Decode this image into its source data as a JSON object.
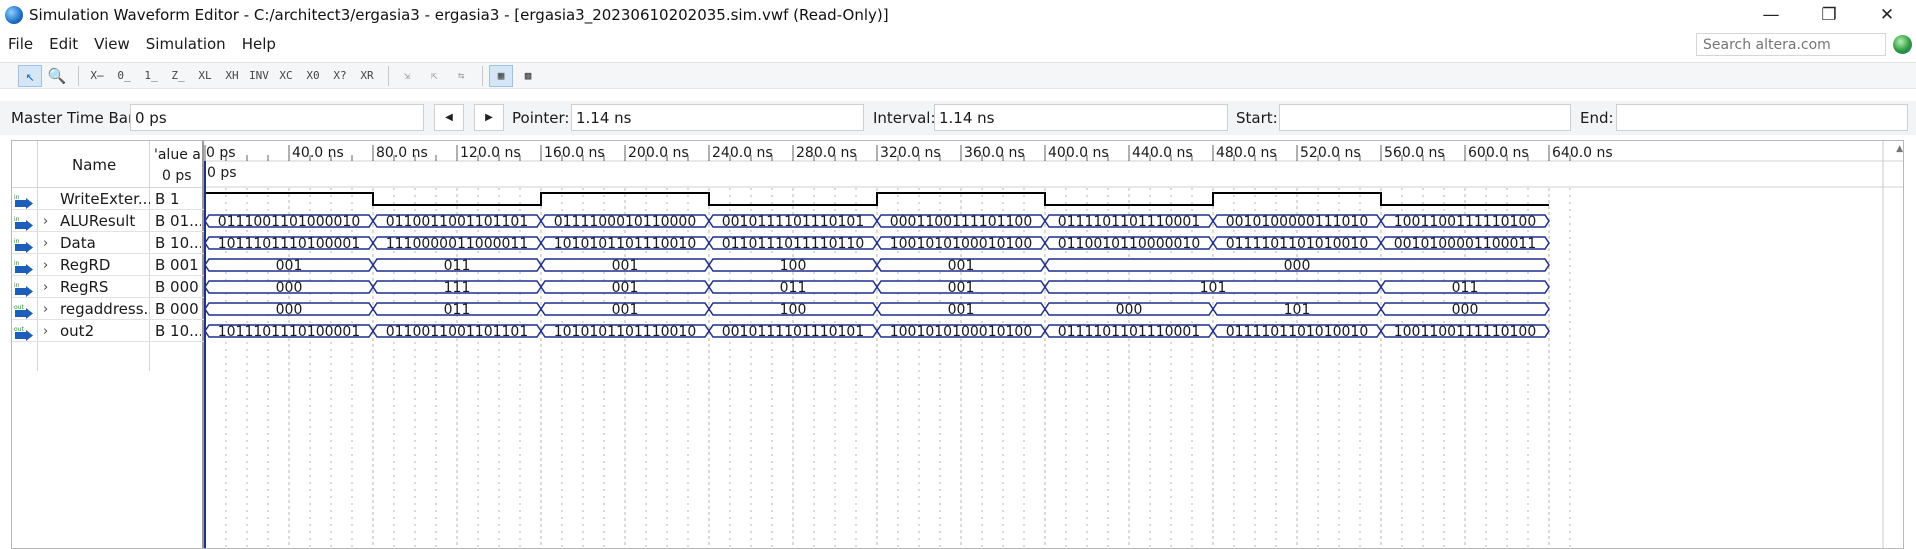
{
  "window": {
    "title": "Simulation Waveform Editor - C:/architect3/ergasia3 - ergasia3 - [ergasia3_20230610202035.sim.vwf (Read-Only)]",
    "minimize": "—",
    "maximize": "❐",
    "close": "✕"
  },
  "menu": {
    "items": [
      "File",
      "Edit",
      "View",
      "Simulation",
      "Help"
    ],
    "search_placeholder": "Search altera.com"
  },
  "toolbar": {
    "buttons": [
      {
        "icon": "pointer-icon",
        "glyph": "↖",
        "active": true
      },
      {
        "icon": "zoom-icon",
        "glyph": "🔍"
      },
      {
        "icon": "force-unknown-icon",
        "glyph": "X̶"
      },
      {
        "icon": "force-low-icon",
        "glyph": "0̲"
      },
      {
        "icon": "force-high-icon",
        "glyph": "1̲"
      },
      {
        "icon": "force-high-impedance-icon",
        "glyph": "Z̲"
      },
      {
        "icon": "force-weak-low-icon",
        "glyph": "XL"
      },
      {
        "icon": "force-weak-high-icon",
        "glyph": "XH"
      },
      {
        "icon": "invert-icon",
        "glyph": "INV"
      },
      {
        "icon": "count-value-icon",
        "glyph": "XC"
      },
      {
        "icon": "clock-icon",
        "glyph": "X0"
      },
      {
        "icon": "arbitrary-value-icon",
        "glyph": "X?"
      },
      {
        "icon": "random-value-icon",
        "glyph": "XR"
      },
      {
        "icon": "snap-icon",
        "glyph": "⇲"
      },
      {
        "icon": "snap-grid-icon",
        "glyph": "⇱"
      },
      {
        "icon": "snap-transition-icon",
        "glyph": "⇆"
      },
      {
        "icon": "fit-window-icon",
        "glyph": "▦",
        "active": true
      },
      {
        "icon": "grid-settings-icon",
        "glyph": "▩"
      }
    ]
  },
  "timebar": {
    "master_label": "Master Time Bar:",
    "master_value": "0 ps",
    "prev_glyph": "◀",
    "next_glyph": "▶",
    "pointer_label": "Pointer:",
    "pointer_value": "1.14 ns",
    "interval_label": "Interval:",
    "interval_value": "1.14 ns",
    "start_label": "Start:",
    "start_value": "",
    "end_label": "End:",
    "end_value": ""
  },
  "columns": {
    "name": "Name",
    "value_line1": "'alue a",
    "value_line2": "0 ps"
  },
  "time_ruler": {
    "labels": [
      "0 ps",
      "40.0 ns",
      "80.0 ns",
      "120.0 ns",
      "160.0 ns",
      "200.0 ns",
      "240.0 ns",
      "280.0 ns",
      "320.0 ns",
      "360.0 ns",
      "400.0 ns",
      "440.0 ns",
      "480.0 ns",
      "520.0 ns",
      "560.0 ns",
      "600.0 ns",
      "640.0 ns"
    ],
    "cursor_label": "0 ps"
  },
  "signals": [
    {
      "name": "WriteExter...",
      "value": "B 1",
      "io": "in",
      "expandable": false,
      "kind": "bit",
      "levels": [
        1,
        0,
        1,
        0,
        1,
        0,
        1,
        0
      ]
    },
    {
      "name": "ALUResult",
      "value": "B 01...",
      "io": "in",
      "expandable": true,
      "kind": "bus",
      "segments": [
        {
          "start": 0,
          "end": 80,
          "text": "0111001101000010"
        },
        {
          "start": 80,
          "end": 160,
          "text": "0110011001101101"
        },
        {
          "start": 160,
          "end": 240,
          "text": "0111100010110000"
        },
        {
          "start": 240,
          "end": 320,
          "text": "0010111101110101"
        },
        {
          "start": 320,
          "end": 400,
          "text": "0001100111101100"
        },
        {
          "start": 400,
          "end": 480,
          "text": "0111101101110001"
        },
        {
          "start": 480,
          "end": 560,
          "text": "0010100000111010"
        },
        {
          "start": 560,
          "end": 640,
          "text": "1001100111110100"
        }
      ]
    },
    {
      "name": "Data",
      "value": "B 10...",
      "io": "in",
      "expandable": true,
      "kind": "bus",
      "segments": [
        {
          "start": 0,
          "end": 80,
          "text": "1011101110100001"
        },
        {
          "start": 80,
          "end": 160,
          "text": "1110000011000011"
        },
        {
          "start": 160,
          "end": 240,
          "text": "1010101101110010"
        },
        {
          "start": 240,
          "end": 320,
          "text": "0110111011110110"
        },
        {
          "start": 320,
          "end": 400,
          "text": "1001010100010100"
        },
        {
          "start": 400,
          "end": 480,
          "text": "0110010110000010"
        },
        {
          "start": 480,
          "end": 560,
          "text": "0111101101010010"
        },
        {
          "start": 560,
          "end": 640,
          "text": "0010100001100011"
        }
      ]
    },
    {
      "name": "RegRD",
      "value": "B 001",
      "io": "in",
      "expandable": true,
      "kind": "bus",
      "segments": [
        {
          "start": 0,
          "end": 80,
          "text": "001"
        },
        {
          "start": 80,
          "end": 160,
          "text": "011"
        },
        {
          "start": 160,
          "end": 240,
          "text": "001"
        },
        {
          "start": 240,
          "end": 320,
          "text": "100"
        },
        {
          "start": 320,
          "end": 400,
          "text": "001"
        },
        {
          "start": 400,
          "end": 640,
          "text": "000"
        }
      ]
    },
    {
      "name": "RegRS",
      "value": "B 000",
      "io": "in",
      "expandable": true,
      "kind": "bus",
      "segments": [
        {
          "start": 0,
          "end": 80,
          "text": "000"
        },
        {
          "start": 80,
          "end": 160,
          "text": "111"
        },
        {
          "start": 160,
          "end": 240,
          "text": "001"
        },
        {
          "start": 240,
          "end": 320,
          "text": "011"
        },
        {
          "start": 320,
          "end": 400,
          "text": "001"
        },
        {
          "start": 400,
          "end": 560,
          "text": "101"
        },
        {
          "start": 560,
          "end": 640,
          "text": "011"
        }
      ]
    },
    {
      "name": "regaddress...",
      "value": "B 000",
      "io": "out",
      "expandable": true,
      "kind": "bus",
      "segments": [
        {
          "start": 0,
          "end": 80,
          "text": "000"
        },
        {
          "start": 80,
          "end": 160,
          "text": "011"
        },
        {
          "start": 160,
          "end": 240,
          "text": "001"
        },
        {
          "start": 240,
          "end": 320,
          "text": "100"
        },
        {
          "start": 320,
          "end": 400,
          "text": "001"
        },
        {
          "start": 400,
          "end": 480,
          "text": "000"
        },
        {
          "start": 480,
          "end": 560,
          "text": "101"
        },
        {
          "start": 560,
          "end": 640,
          "text": "000"
        }
      ]
    },
    {
      "name": "out2",
      "value": "B 10...",
      "io": "out",
      "expandable": true,
      "kind": "bus",
      "segments": [
        {
          "start": 0,
          "end": 80,
          "text": "1011101110100001"
        },
        {
          "start": 80,
          "end": 160,
          "text": "0110011001101101"
        },
        {
          "start": 160,
          "end": 240,
          "text": "1010101101110010"
        },
        {
          "start": 240,
          "end": 320,
          "text": "0010111101110101"
        },
        {
          "start": 320,
          "end": 400,
          "text": "1001010100010100"
        },
        {
          "start": 400,
          "end": 480,
          "text": "0111101101110001"
        },
        {
          "start": 480,
          "end": 560,
          "text": "0111101101010010"
        },
        {
          "start": 560,
          "end": 640,
          "text": "1001100111110100"
        }
      ]
    }
  ],
  "colors": {
    "wave_bus": "#1f2f8a",
    "wave_bit": "#000000",
    "grid": "#b4b4b4",
    "cursor": "#1f2f8a"
  }
}
